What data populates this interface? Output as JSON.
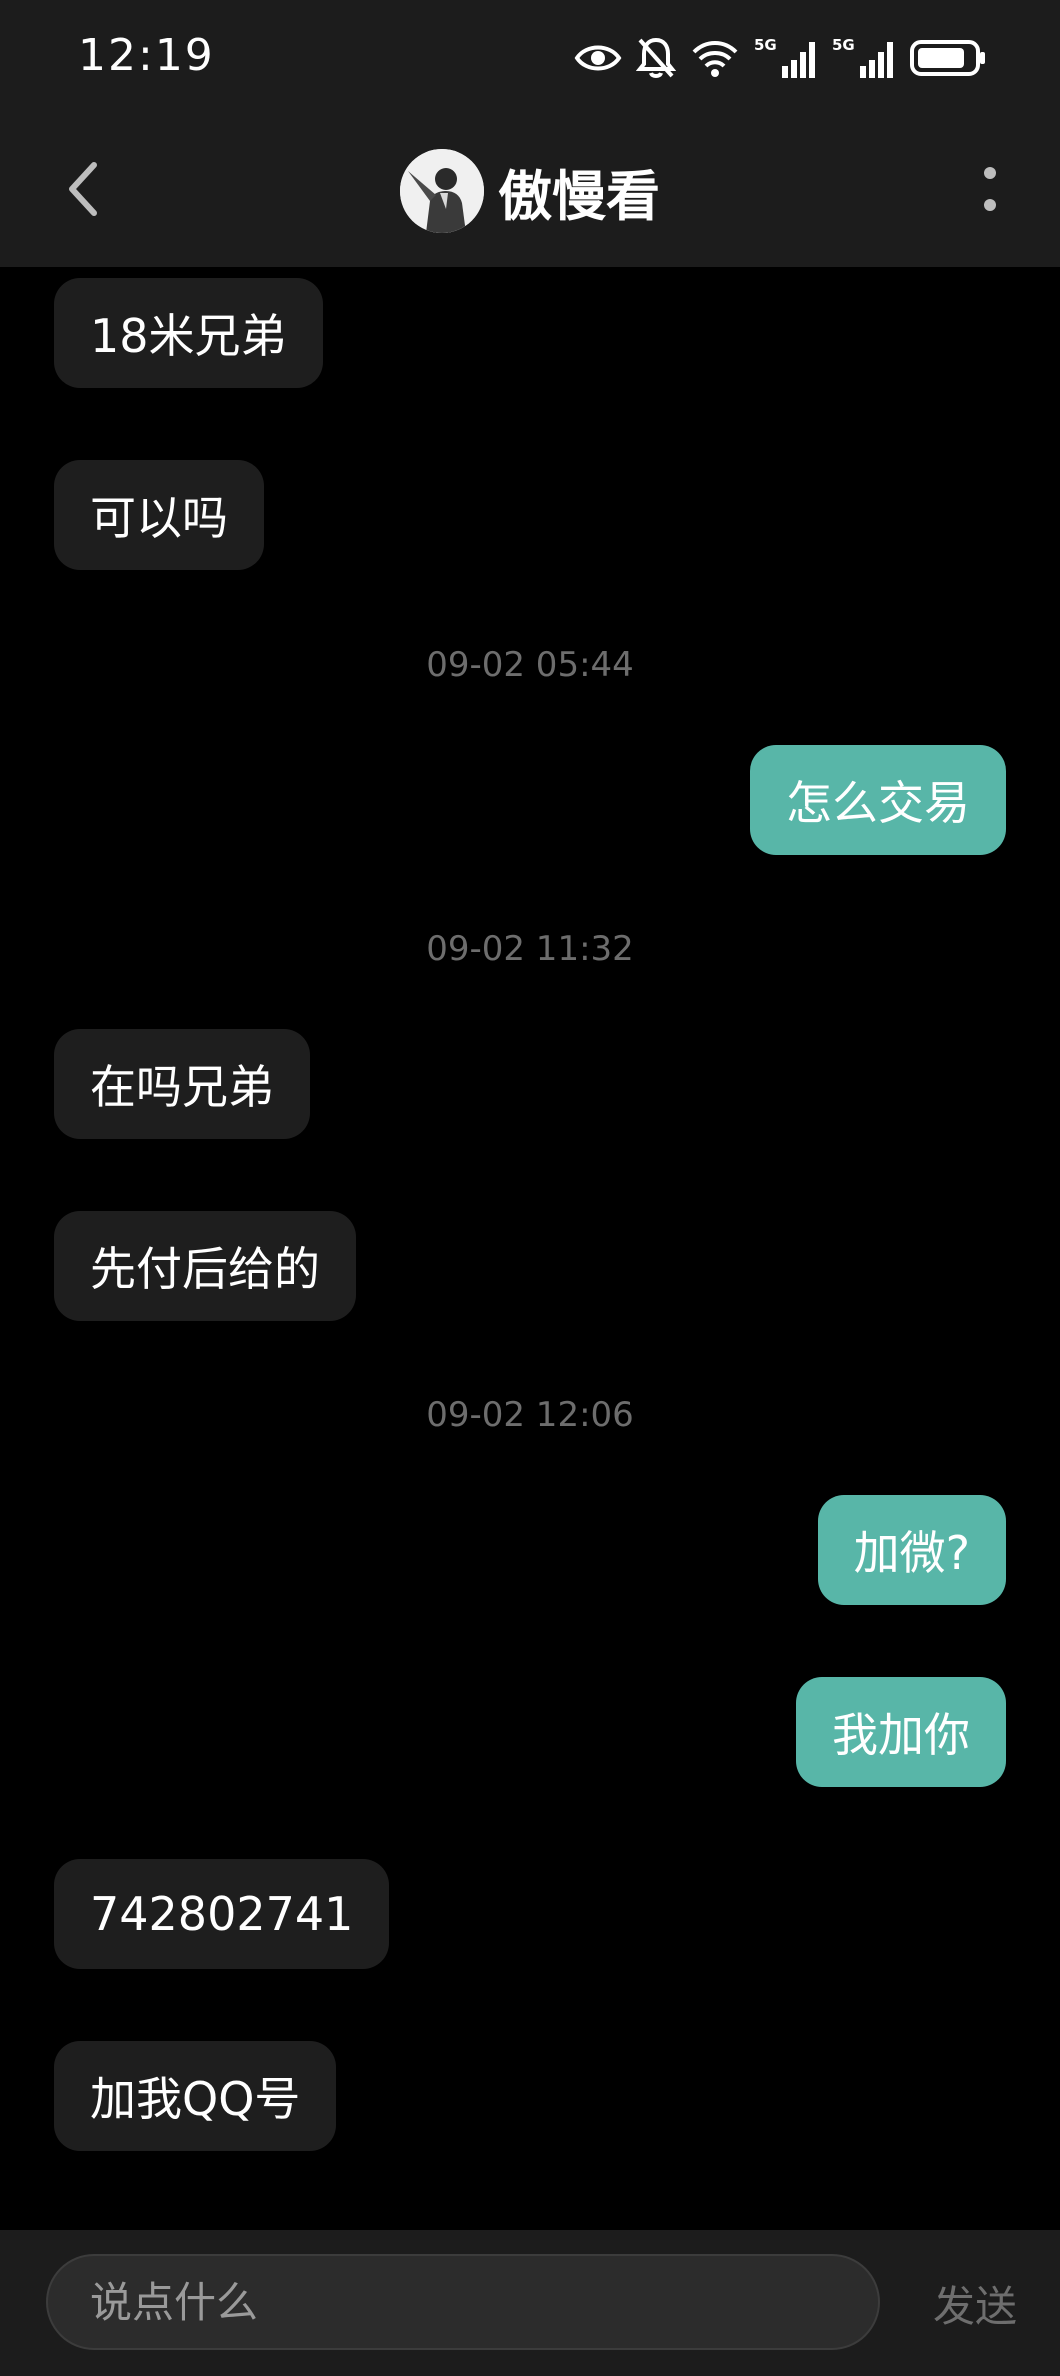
{
  "status_bar": {
    "time": "12:19",
    "icons": [
      "eye-icon",
      "bell-off-icon",
      "wifi-icon",
      "signal-5g-icon",
      "signal-5g-icon",
      "battery-icon"
    ],
    "network_label_1": "5G",
    "network_label_2": "5G"
  },
  "header": {
    "title": "傲慢看",
    "back_icon": "chevron-left-icon",
    "more_icon": "more-vertical-icon"
  },
  "messages": [
    {
      "type": "in",
      "text": "18米兄弟"
    },
    {
      "type": "in",
      "text": "可以吗"
    },
    {
      "type": "time",
      "text": "09-02 05:44"
    },
    {
      "type": "out",
      "text": "怎么交易"
    },
    {
      "type": "time",
      "text": "09-02 11:32"
    },
    {
      "type": "in",
      "text": "在吗兄弟"
    },
    {
      "type": "in",
      "text": "先付后给的"
    },
    {
      "type": "time",
      "text": "09-02 12:06"
    },
    {
      "type": "out",
      "text": "加微?"
    },
    {
      "type": "out",
      "text": "我加你"
    },
    {
      "type": "in",
      "text": "742802741"
    },
    {
      "type": "in",
      "text": "加我QQ号"
    }
  ],
  "input_bar": {
    "placeholder": "说点什么",
    "value": "",
    "send_label": "发送"
  },
  "colors": {
    "outgoing_bubble": "#58b6a8",
    "incoming_bubble": "#1e1e1e",
    "bar_background": "#1c1c1c",
    "background": "#000000"
  }
}
